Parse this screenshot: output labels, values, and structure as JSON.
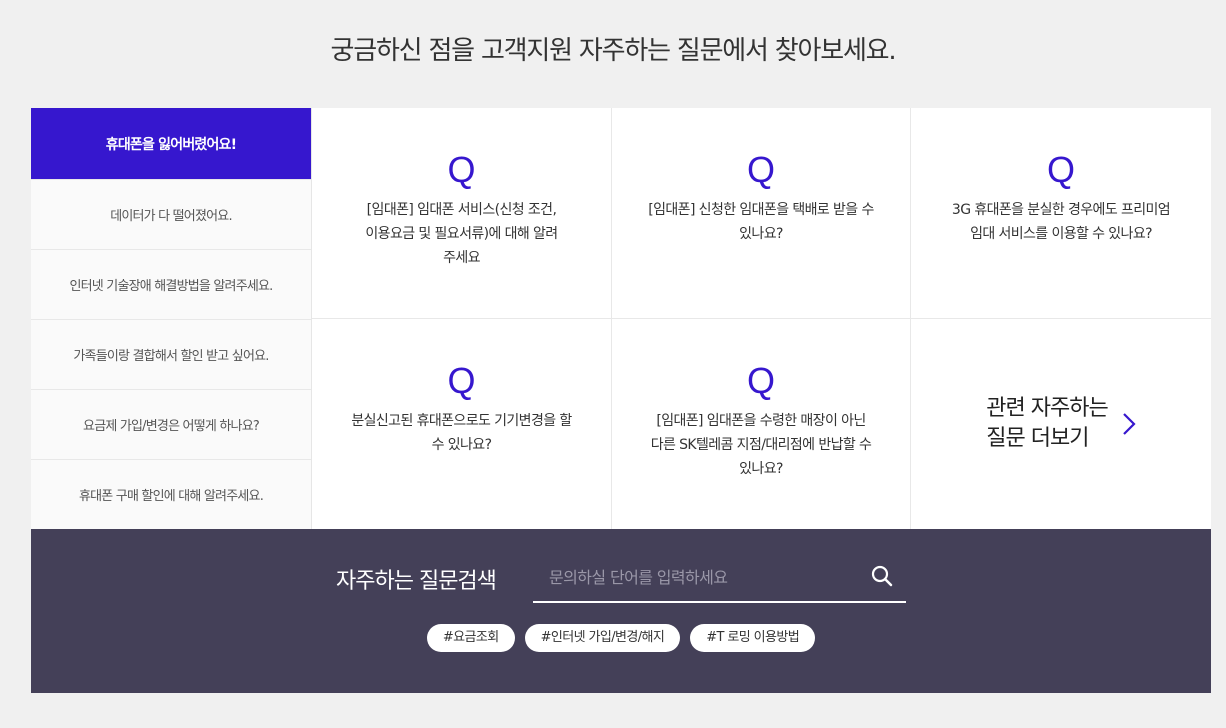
{
  "heading": "궁금하신 점을 고객지원 자주하는 질문에서 찾아보세요.",
  "sidebar": {
    "items": [
      {
        "label": "휴대폰을 잃어버렸어요!"
      },
      {
        "label": "데이터가 다 떨어졌어요."
      },
      {
        "label": "인터넷 기술장애 해결방법을 알려주세요."
      },
      {
        "label": "가족들이랑 결합해서 할인 받고 싶어요."
      },
      {
        "label": "요금제 가입/변경은 어떻게 하나요?"
      },
      {
        "label": "휴대폰 구매 할인에 대해 알려주세요."
      }
    ]
  },
  "faq": {
    "q_mark": "Q",
    "items": [
      {
        "line1": "[임대폰] 임대폰 서비스(신청 조건,",
        "line2": "이용요금 및 필요서류)에 대해 알려",
        "line3": "주세요"
      },
      {
        "line1": "[임대폰] 신청한 임대폰을 택배로 받을 수",
        "line2": "있나요?",
        "line3": ""
      },
      {
        "line1": "3G 휴대폰을 분실한 경우에도 프리미엄",
        "line2": "임대 서비스를 이용할 수 있나요?",
        "line3": ""
      },
      {
        "line1": "분실신고된 휴대폰으로도 기기변경을 할",
        "line2": "수 있나요?",
        "line3": ""
      },
      {
        "line1": "[임대폰] 임대폰을 수령한 매장이 아닌",
        "line2": "다른 SK텔레콤 지점/대리점에 반납할 수",
        "line3": "있나요?"
      }
    ],
    "more_line1": "관련 자주하는",
    "more_line2": "질문 더보기",
    "more_icon": "chevron-right-icon"
  },
  "search": {
    "title": "자주하는 질문검색",
    "placeholder": "문의하실 단어를 입력하세요",
    "icon": "search-icon",
    "tags": [
      "#요금조회",
      "#인터넷 가입/변경/해지",
      "#T 로밍 이용방법"
    ]
  },
  "colors": {
    "accent": "#3617ce",
    "band": "#444058",
    "page_bg": "#f0f0f0"
  }
}
